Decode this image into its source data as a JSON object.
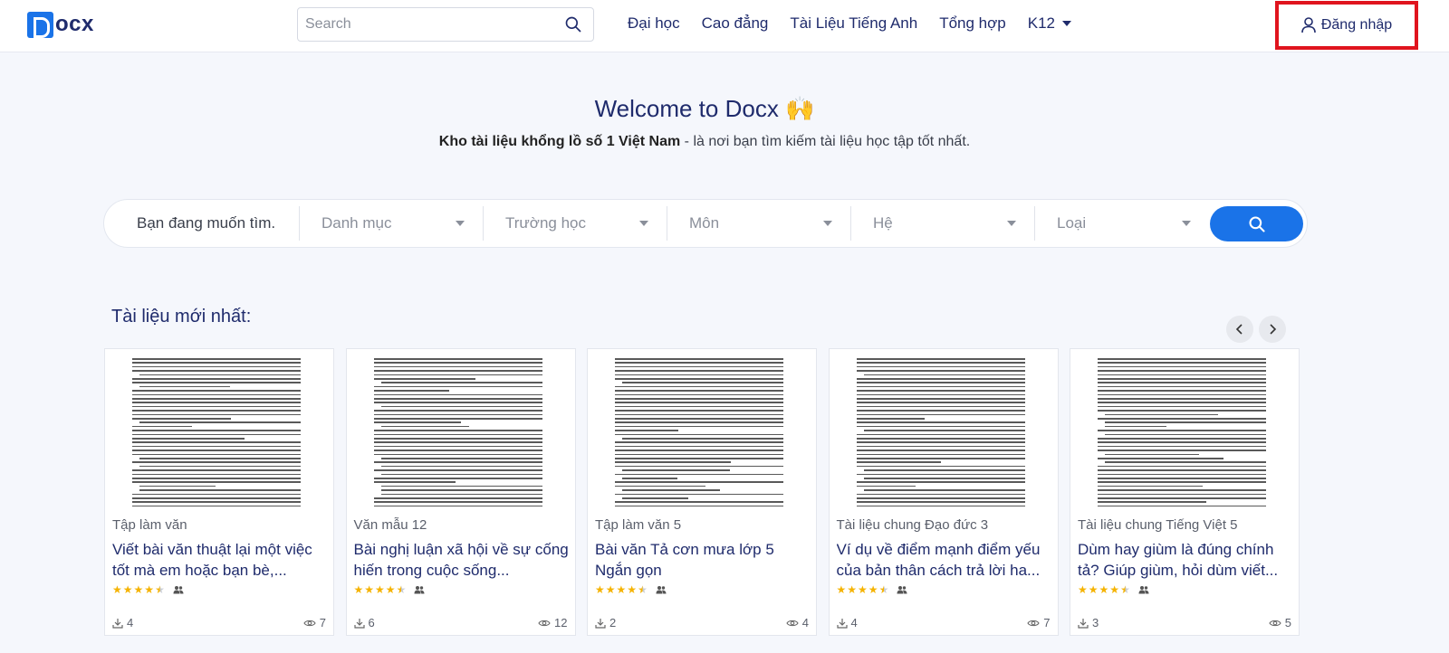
{
  "header": {
    "logo_text": "ocx",
    "search_placeholder": "Search",
    "nav": [
      "Đại học",
      "Cao đẳng",
      "Tài Liệu Tiếng Anh",
      "Tổng hợp",
      "K12"
    ],
    "login_label": "Đăng nhập",
    "login_highlight_color": "#e0141e"
  },
  "hero": {
    "title": "Welcome to Docx 🙌",
    "subtitle_bold": "Kho tài liệu khổng lồ số 1 Việt Nam",
    "subtitle_rest": " - là nơi bạn tìm kiếm tài liệu học tập tốt nhất."
  },
  "filters": {
    "input_text": "Bạn đang muốn tìm.",
    "selects": [
      "Danh mục",
      "Trường học",
      "Môn",
      "Hệ",
      "Loại"
    ]
  },
  "section": {
    "title": "Tài liệu mới nhất:"
  },
  "documents": [
    {
      "category": "Tập làm văn",
      "title": "Viết bài văn thuật lại một việc tốt mà em hoặc bạn bè,...",
      "stars": 4.5,
      "downloads": "4",
      "views": "7"
    },
    {
      "category": "Văn mẫu 12",
      "title": "Bài nghị luận xã hội về sự cống hiến trong cuộc sống...",
      "stars": 4.5,
      "downloads": "6",
      "views": "12"
    },
    {
      "category": "Tập làm văn 5",
      "title": "Bài văn Tả cơn mưa lớp 5 Ngắn gọn",
      "stars": 4.5,
      "downloads": "2",
      "views": "4"
    },
    {
      "category": "Tài liệu chung Đạo đức 3",
      "title": "Ví dụ về điểm mạnh điểm yếu của bản thân cách trả lời ha...",
      "stars": 4.5,
      "downloads": "4",
      "views": "7"
    },
    {
      "category": "Tài liệu chung Tiếng Việt 5",
      "title": "Dùm hay giùm là đúng chính tả? Giúp giùm, hỏi dùm viết...",
      "stars": 4.5,
      "downloads": "3",
      "views": "5"
    }
  ],
  "colors": {
    "primary": "#1a73e8",
    "navy": "#1f2b6c",
    "star": "#f5b301"
  }
}
